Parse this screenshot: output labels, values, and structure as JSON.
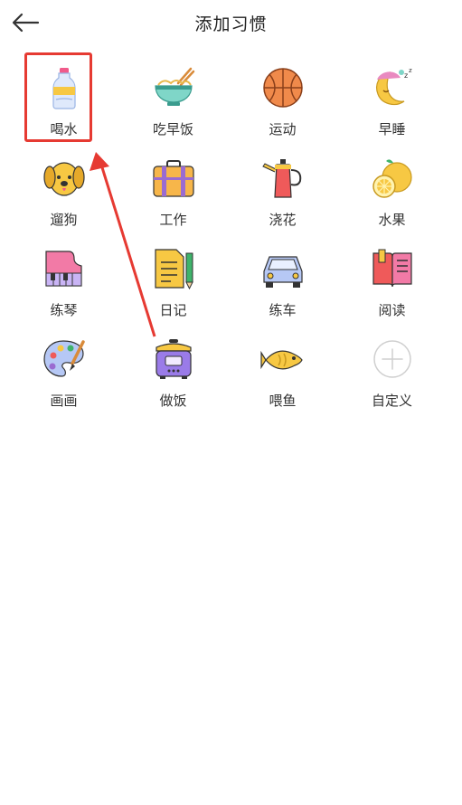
{
  "header": {
    "title": "添加习惯",
    "back_icon": "arrow-left-icon"
  },
  "habits": [
    {
      "label": "喝水",
      "icon": "water-bottle-icon"
    },
    {
      "label": "吃早饭",
      "icon": "noodle-bowl-icon"
    },
    {
      "label": "运动",
      "icon": "basketball-icon"
    },
    {
      "label": "早睡",
      "icon": "moon-sleep-icon"
    },
    {
      "label": "遛狗",
      "icon": "dog-icon"
    },
    {
      "label": "工作",
      "icon": "briefcase-icon"
    },
    {
      "label": "浇花",
      "icon": "watering-can-icon"
    },
    {
      "label": "水果",
      "icon": "fruit-icon"
    },
    {
      "label": "练琴",
      "icon": "piano-icon"
    },
    {
      "label": "日记",
      "icon": "notepad-icon"
    },
    {
      "label": "练车",
      "icon": "car-icon"
    },
    {
      "label": "阅读",
      "icon": "book-icon"
    },
    {
      "label": "画画",
      "icon": "palette-icon"
    },
    {
      "label": "做饭",
      "icon": "cooker-icon"
    },
    {
      "label": "喂鱼",
      "icon": "fish-icon"
    },
    {
      "label": "自定义",
      "icon": "plus-circle-icon"
    }
  ],
  "colors": {
    "highlight": "#e63a32",
    "accent_yellow": "#f7c843",
    "accent_purple": "#9a7be8"
  }
}
